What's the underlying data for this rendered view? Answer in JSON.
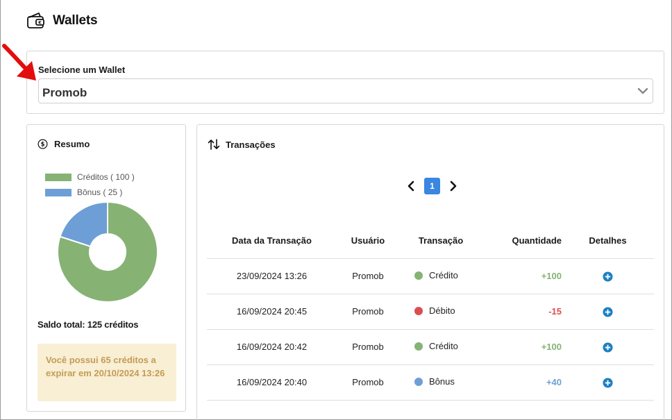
{
  "header": {
    "title": "Wallets",
    "icon": "wallet-icon"
  },
  "wallet_select": {
    "label": "Selecione um Wallet",
    "value": "Promob"
  },
  "resumo": {
    "title": "Resumo",
    "legend": [
      {
        "label": "Créditos ( 100 )",
        "color": "#86b374"
      },
      {
        "label": "Bônus ( 25 )",
        "color": "#6d9fd6"
      }
    ],
    "saldo": "Saldo total: 125 créditos",
    "alert": "Você possui 65 créditos a expirar em 20/10/2024 13:26"
  },
  "chart_data": {
    "type": "pie",
    "categories": [
      "Créditos",
      "Bônus"
    ],
    "values": [
      100,
      25
    ],
    "colors": [
      "#86b374",
      "#6d9fd6"
    ],
    "legend_position": "top-left"
  },
  "transacoes": {
    "title": "Transações",
    "pagination": {
      "current_page": "1"
    },
    "columns": [
      "Data da Transação",
      "Usuário",
      "Transação",
      "Quantidade",
      "Detalhes"
    ],
    "rows": [
      {
        "date": "23/09/2024 13:26",
        "user": "Promob",
        "type": "Crédito",
        "type_color": "#86b374",
        "qty": "+100",
        "qty_color": "#86b374"
      },
      {
        "date": "16/09/2024 20:45",
        "user": "Promob",
        "type": "Débito",
        "type_color": "#dc4e4e",
        "qty": "-15",
        "qty_color": "#dc4e4e"
      },
      {
        "date": "16/09/2024 20:42",
        "user": "Promob",
        "type": "Crédito",
        "type_color": "#86b374",
        "qty": "+100",
        "qty_color": "#86b374"
      },
      {
        "date": "16/09/2024 20:40",
        "user": "Promob",
        "type": "Bônus",
        "type_color": "#6d9fd6",
        "qty": "+40",
        "qty_color": "#6d9fd6"
      }
    ]
  }
}
